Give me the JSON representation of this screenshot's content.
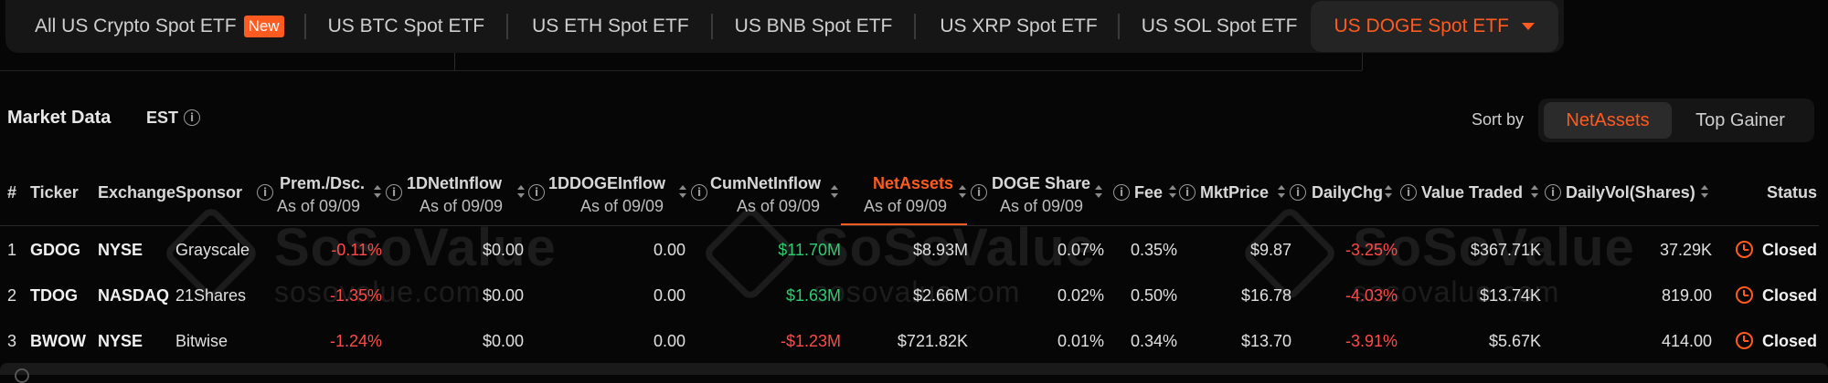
{
  "tabs": [
    {
      "label": "All US Crypto Spot ETF",
      "badge": "New"
    },
    {
      "label": "US BTC Spot ETF"
    },
    {
      "label": "US ETH Spot ETF"
    },
    {
      "label": "US BNB Spot ETF"
    },
    {
      "label": "US XRP Spot ETF"
    },
    {
      "label": "US SOL Spot ETF"
    },
    {
      "label": "US DOGE Spot ETF",
      "active": true
    }
  ],
  "market": {
    "title": "Market Data",
    "timezone": "EST",
    "sort_label": "Sort by",
    "sort_options": [
      "NetAssets",
      "Top Gainer"
    ],
    "sort_selected": "NetAssets"
  },
  "columns": {
    "num": "#",
    "ticker": "Ticker",
    "exchange": "Exchange",
    "sponsor": "Sponsor",
    "premium": "Prem./Dsc.",
    "inflow": "1DNetInflow",
    "doge_inflow": "1DDOGEInflow",
    "cum_inflow": "CumNetInflow",
    "net_assets": "NetAssets",
    "doge_share": "DOGE Share",
    "fee": "Fee",
    "mkt_price": "MktPrice",
    "daily_chg": "DailyChg",
    "value_traded": "Value Traded",
    "daily_vol": "DailyVol(Shares)",
    "status": "Status",
    "as_of": "As of 09/09"
  },
  "rows": [
    {
      "num": "1",
      "ticker": "GDOG",
      "exchange": "NYSE",
      "sponsor": "Grayscale",
      "premium": "-0.11%",
      "inflow": "$0.00",
      "doge_inflow": "0.00",
      "cum_inflow": "$11.70M",
      "net_assets": "$8.93M",
      "doge_share": "0.07%",
      "fee": "0.35%",
      "mkt_price": "$9.87",
      "daily_chg": "-3.25%",
      "value_traded": "$367.71K",
      "daily_vol": "37.29K",
      "status": "Closed"
    },
    {
      "num": "2",
      "ticker": "TDOG",
      "exchange": "NASDAQ",
      "sponsor": "21Shares",
      "premium": "-1.35%",
      "inflow": "$0.00",
      "doge_inflow": "0.00",
      "cum_inflow": "$1.63M",
      "net_assets": "$2.66M",
      "doge_share": "0.02%",
      "fee": "0.50%",
      "mkt_price": "$16.78",
      "daily_chg": "-4.03%",
      "value_traded": "$13.74K",
      "daily_vol": "819.00",
      "status": "Closed"
    },
    {
      "num": "3",
      "ticker": "BWOW",
      "exchange": "NYSE",
      "sponsor": "Bitwise",
      "premium": "-1.24%",
      "inflow": "$0.00",
      "doge_inflow": "0.00",
      "cum_inflow": "-$1.23M",
      "net_assets": "$721.82K",
      "doge_share": "0.01%",
      "fee": "0.34%",
      "mkt_price": "$13.70",
      "daily_chg": "-3.91%",
      "value_traded": "$5.67K",
      "daily_vol": "414.00",
      "status": "Closed"
    }
  ],
  "watermark": {
    "brand": "SoSoValue",
    "domain": "sosovalue.com"
  },
  "colors": {
    "accent": "#ff5a1f",
    "negative": "#ff4a4a",
    "positive": "#2ecc71",
    "background": "#060606"
  }
}
